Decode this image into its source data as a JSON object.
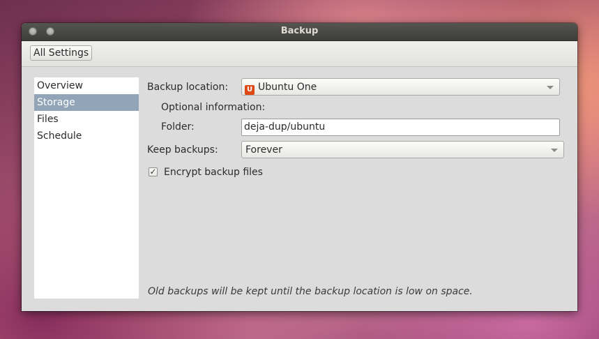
{
  "window": {
    "title": "Backup"
  },
  "toolbar": {
    "all_settings_label": "All Settings"
  },
  "sidebar": {
    "items": [
      {
        "label": "Overview",
        "selected": false
      },
      {
        "label": "Storage",
        "selected": true
      },
      {
        "label": "Files",
        "selected": false
      },
      {
        "label": "Schedule",
        "selected": false
      }
    ]
  },
  "storage": {
    "backup_location_label": "Backup location:",
    "backup_location_value": "Ubuntu One",
    "backup_location_icon": "U",
    "optional_info_label": "Optional information:",
    "folder_label": "Folder:",
    "folder_value": "deja-dup/ubuntu",
    "keep_backups_label": "Keep backups:",
    "keep_backups_value": "Forever",
    "encrypt_label": "Encrypt backup files",
    "encrypt_checked": true,
    "check_glyph": "✓",
    "footnote": "Old backups will be kept until the backup location is low on space."
  },
  "colors": {
    "selection": "#92a5b8",
    "ubuntu_one_icon": "#dd4814",
    "titlebar": "#3d3d3a"
  }
}
